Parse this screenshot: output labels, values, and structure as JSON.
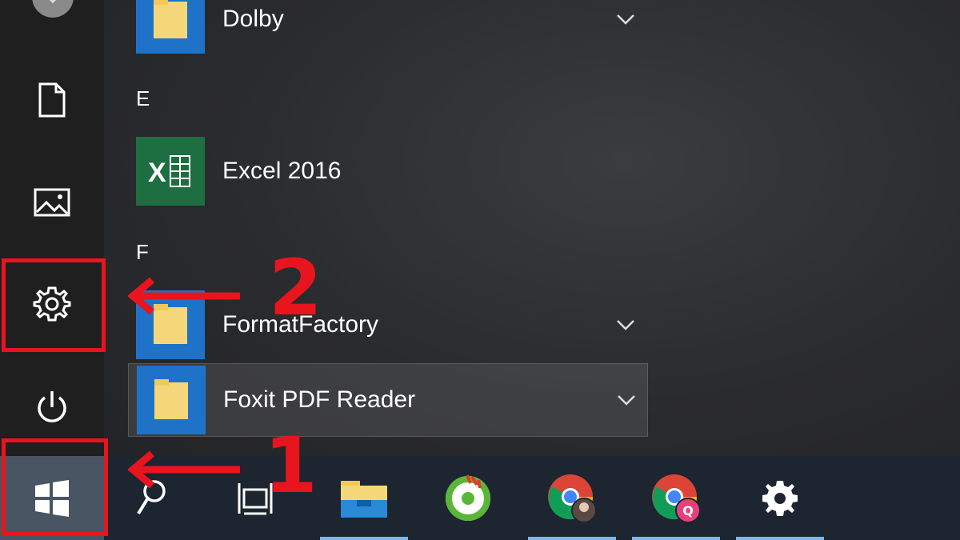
{
  "start_menu": {
    "apps": [
      {
        "label": "Dolby",
        "icon": "folder-icon",
        "expandable": true
      },
      {
        "label": "Excel 2016",
        "icon": "excel-icon",
        "expandable": false
      },
      {
        "label": "FormatFactory",
        "icon": "folder-icon",
        "expandable": true
      },
      {
        "label": "Foxit PDF Reader",
        "icon": "folder-icon",
        "expandable": true
      }
    ],
    "group_letters": [
      "E",
      "F"
    ],
    "sidebar": [
      "user-avatar-icon",
      "document-icon",
      "pictures-icon",
      "settings-gear-icon",
      "power-icon"
    ]
  },
  "taskbar": {
    "items": [
      "windows-start-icon",
      "search-icon",
      "task-view-icon",
      "file-explorer-icon",
      "coc-coc-browser-icon",
      "chrome-profile-1-icon",
      "chrome-profile-q-icon",
      "settings-gear-icon"
    ],
    "chrome_badge": "Q"
  },
  "annotations": {
    "step_1": "1",
    "step_2": "2",
    "color": "#e8141e"
  }
}
